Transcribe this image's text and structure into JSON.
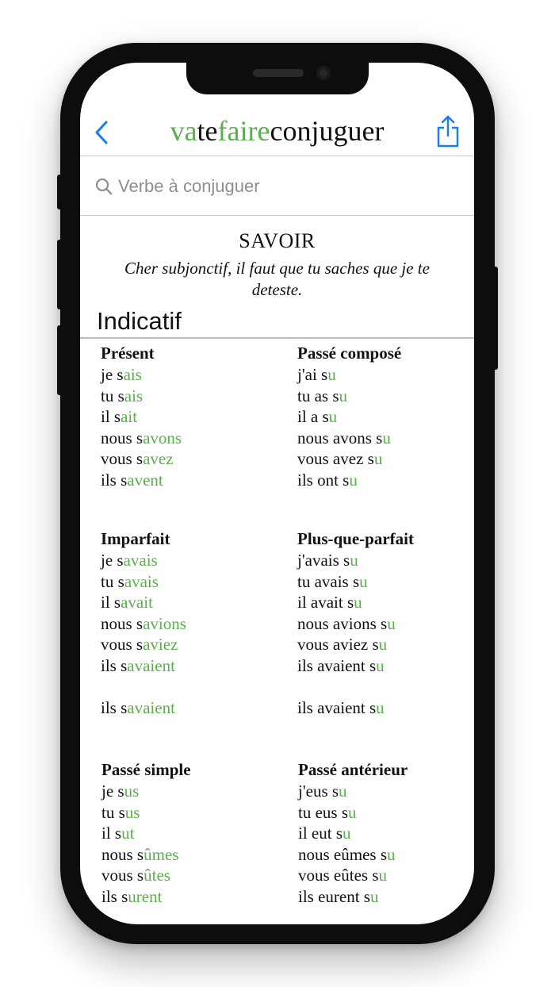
{
  "app": {
    "title_parts": [
      {
        "text": "va",
        "green": true
      },
      {
        "text": "te",
        "green": false
      },
      {
        "text": "faire",
        "green": true
      },
      {
        "text": "conjuguer",
        "green": false
      }
    ]
  },
  "search": {
    "placeholder": "Verbe à conjuguer",
    "value": ""
  },
  "verb": "SAVOIR",
  "quote": "Cher subjonctif, il faut que tu saches que je te deteste.",
  "mood": "Indicatif",
  "colors": {
    "accent_green": "#5cae4d",
    "ios_blue": "#1a7ef0"
  },
  "icons": {
    "back": "chevron-left-icon",
    "share": "share-icon",
    "search": "search-icon"
  },
  "tenses": [
    {
      "name": "Présent",
      "rows": [
        {
          "stem": "je s",
          "ending": "ais"
        },
        {
          "stem": "tu s",
          "ending": "ais"
        },
        {
          "stem": "il s",
          "ending": "ait"
        },
        {
          "stem": "nous s",
          "ending": "avons"
        },
        {
          "stem": "vous s",
          "ending": "avez"
        },
        {
          "stem": "ils s",
          "ending": "avent"
        }
      ]
    },
    {
      "name": "Passé composé",
      "rows": [
        {
          "stem": "j'ai s",
          "ending": "u"
        },
        {
          "stem": "tu as s",
          "ending": "u"
        },
        {
          "stem": "il a s",
          "ending": "u"
        },
        {
          "stem": "nous avons s",
          "ending": "u"
        },
        {
          "stem": "vous avez s",
          "ending": "u"
        },
        {
          "stem": "ils ont s",
          "ending": "u"
        }
      ]
    },
    {
      "name": "Imparfait",
      "rows": [
        {
          "stem": "je s",
          "ending": "avais"
        },
        {
          "stem": "tu s",
          "ending": "avais"
        },
        {
          "stem": "il s",
          "ending": "avait"
        },
        {
          "stem": "nous s",
          "ending": "avions"
        },
        {
          "stem": "vous s",
          "ending": "aviez"
        },
        {
          "stem": "ils s",
          "ending": "avaient"
        },
        {
          "stem": "",
          "ending": ""
        },
        {
          "stem": "ils s",
          "ending": "avaient"
        }
      ]
    },
    {
      "name": "Plus-que-parfait",
      "rows": [
        {
          "stem": "j'avais s",
          "ending": "u"
        },
        {
          "stem": "tu avais s",
          "ending": "u"
        },
        {
          "stem": "il avait s",
          "ending": "u"
        },
        {
          "stem": "nous avions s",
          "ending": "u"
        },
        {
          "stem": "vous aviez s",
          "ending": "u"
        },
        {
          "stem": "ils avaient s",
          "ending": "u"
        },
        {
          "stem": "",
          "ending": ""
        },
        {
          "stem": "ils avaient s",
          "ending": "u"
        }
      ]
    },
    {
      "name": "Passé simple",
      "rows": [
        {
          "stem": "je s",
          "ending": "us"
        },
        {
          "stem": "tu s",
          "ending": "us"
        },
        {
          "stem": "il s",
          "ending": "ut"
        },
        {
          "stem": "nous s",
          "ending": "ûmes"
        },
        {
          "stem": "vous s",
          "ending": "ûtes"
        },
        {
          "stem": "ils s",
          "ending": "urent"
        }
      ]
    },
    {
      "name": "Passé antérieur",
      "rows": [
        {
          "stem": "j'eus s",
          "ending": "u"
        },
        {
          "stem": "tu eus s",
          "ending": "u"
        },
        {
          "stem": "il eut s",
          "ending": "u"
        },
        {
          "stem": "nous eûmes s",
          "ending": "u"
        },
        {
          "stem": "vous eûtes s",
          "ending": "u"
        },
        {
          "stem": "ils eurent s",
          "ending": "u"
        }
      ]
    }
  ]
}
